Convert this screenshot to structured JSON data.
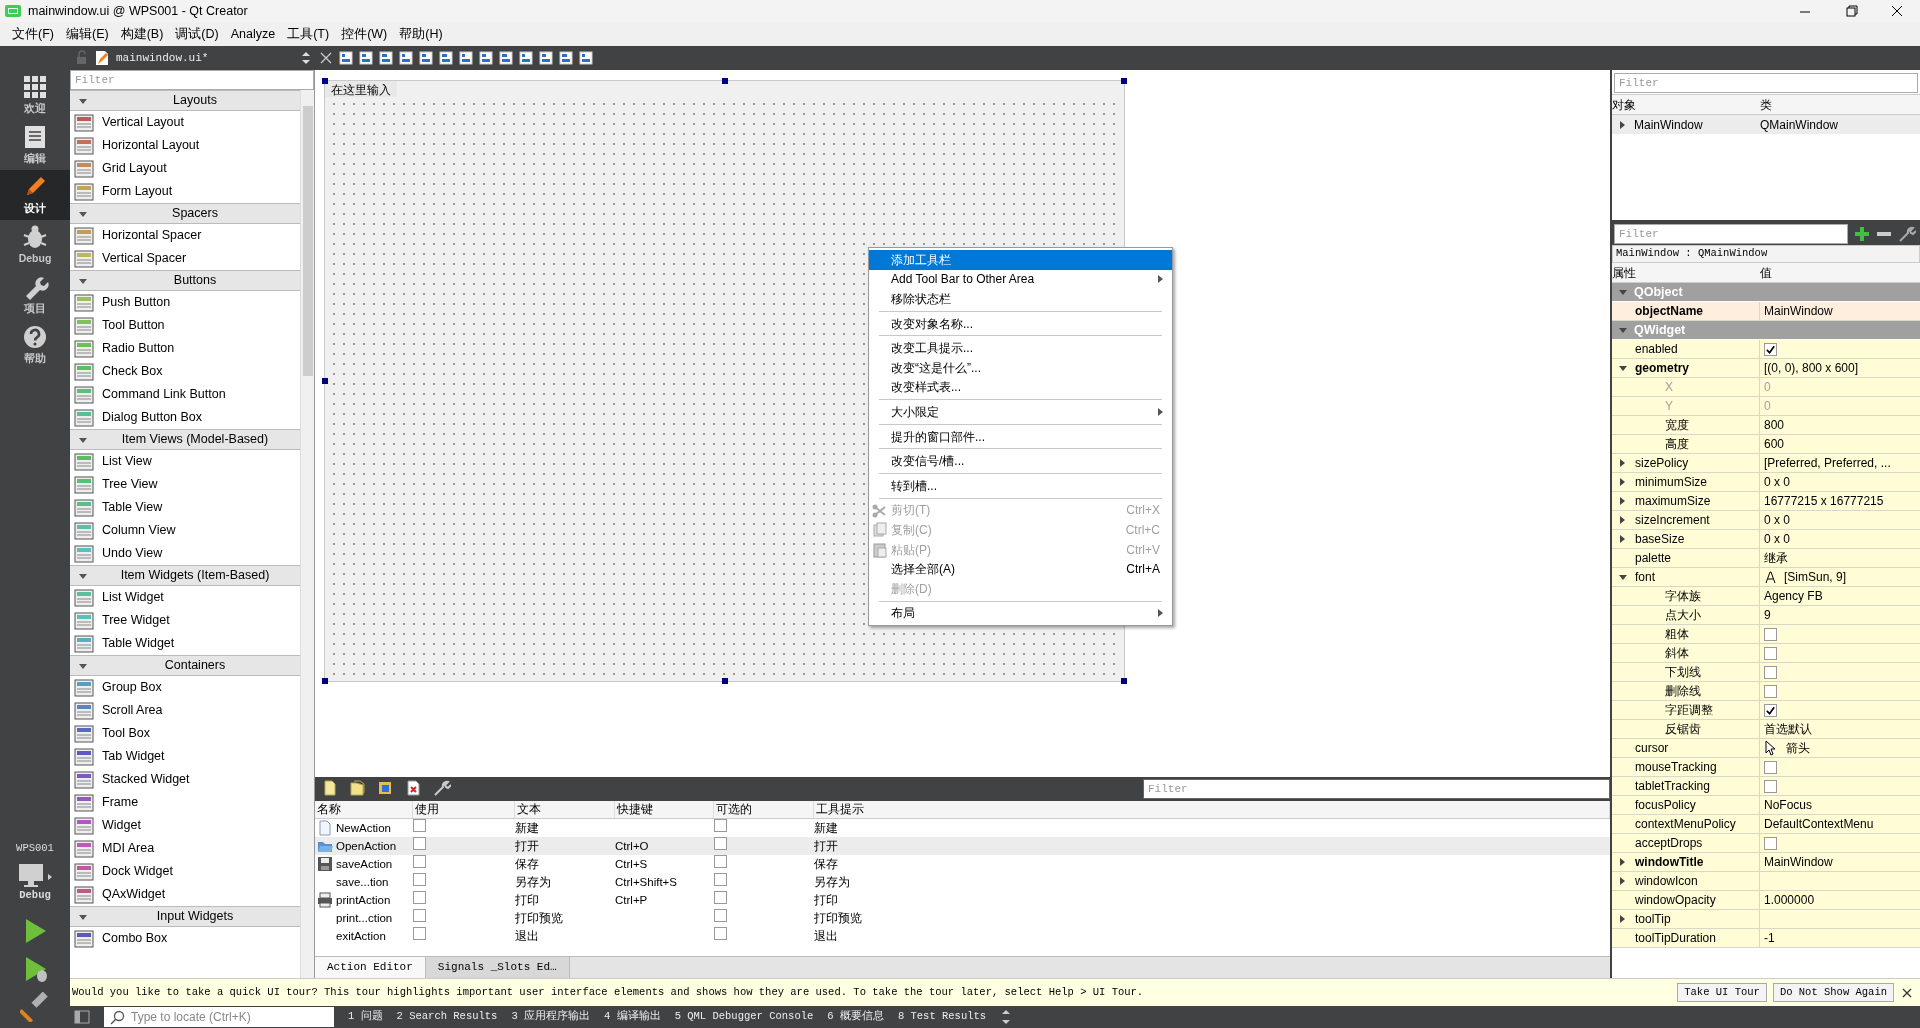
{
  "window": {
    "title": "mainwindow.ui @ WPS001 - Qt Creator"
  },
  "menu": [
    "文件(F)",
    "编辑(E)",
    "构建(B)",
    "调试(D)",
    "Analyze",
    "工具(T)",
    "控件(W)",
    "帮助(H)"
  ],
  "modes": [
    {
      "label": "欢迎",
      "selected": false
    },
    {
      "label": "编辑",
      "selected": false
    },
    {
      "label": "设计",
      "selected": true
    },
    {
      "label": "Debug",
      "selected": false
    },
    {
      "label": "项目",
      "selected": false
    },
    {
      "label": "帮助",
      "selected": false
    }
  ],
  "kit": {
    "project": "WPS001",
    "build": "Debug"
  },
  "editor_toolbar": {
    "file": "mainwindow.ui*"
  },
  "widget_box": {
    "placeholder": "Filter",
    "categories": [
      {
        "title": "Layouts",
        "expanded": true,
        "items": [
          "Vertical Layout",
          "Horizontal Layout",
          "Grid Layout",
          "Form Layout"
        ]
      },
      {
        "title": "Spacers",
        "expanded": true,
        "items": [
          "Horizontal Spacer",
          "Vertical Spacer"
        ]
      },
      {
        "title": "Buttons",
        "expanded": true,
        "items": [
          "Push Button",
          "Tool Button",
          "Radio Button",
          "Check Box",
          "Command Link Button",
          "Dialog Button Box"
        ]
      },
      {
        "title": "Item Views (Model-Based)",
        "expanded": true,
        "items": [
          "List View",
          "Tree View",
          "Table View",
          "Column View",
          "Undo View"
        ]
      },
      {
        "title": "Item Widgets (Item-Based)",
        "expanded": true,
        "items": [
          "List Widget",
          "Tree Widget",
          "Table Widget"
        ]
      },
      {
        "title": "Containers",
        "expanded": true,
        "items": [
          "Group Box",
          "Scroll Area",
          "Tool Box",
          "Tab Widget",
          "Stacked Widget",
          "Frame",
          "Widget",
          "MDI Area",
          "Dock Widget",
          "QAxWidget"
        ]
      },
      {
        "title": "Input Widgets",
        "expanded": true,
        "items": [
          "Combo Box"
        ]
      }
    ]
  },
  "form": {
    "menu_placeholder": "在这里输入"
  },
  "context_menu": [
    {
      "kind": "item",
      "label": "添加工具栏",
      "selected": true
    },
    {
      "kind": "item",
      "label": "Add Tool Bar to Other Area",
      "submenu": true,
      "selected": false
    },
    {
      "kind": "item",
      "label": "移除状态栏",
      "selected": false
    },
    {
      "kind": "separator"
    },
    {
      "kind": "item",
      "label": "改变对象名称...",
      "selected": false
    },
    {
      "kind": "separator"
    },
    {
      "kind": "item",
      "label": "改变工具提示...",
      "selected": false
    },
    {
      "kind": "item",
      "label": "改变“这是什么”...",
      "selected": false
    },
    {
      "kind": "item",
      "label": "改变样式表...",
      "selected": false
    },
    {
      "kind": "separator"
    },
    {
      "kind": "item",
      "label": "大小限定",
      "submenu": true,
      "selected": false
    },
    {
      "kind": "separator"
    },
    {
      "kind": "item",
      "label": "提升的窗口部件...",
      "selected": false
    },
    {
      "kind": "separator"
    },
    {
      "kind": "item",
      "label": "改变信号/槽...",
      "selected": false
    },
    {
      "kind": "separator"
    },
    {
      "kind": "item",
      "label": "转到槽...",
      "selected": false
    },
    {
      "kind": "separator"
    },
    {
      "kind": "item",
      "label": "剪切(T)",
      "shortcut": "Ctrl+X",
      "disabled": true,
      "selected": false
    },
    {
      "kind": "item",
      "label": "复制(C)",
      "shortcut": "Ctrl+C",
      "disabled": true,
      "selected": false
    },
    {
      "kind": "item",
      "label": "粘贴(P)",
      "shortcut": "Ctrl+V",
      "disabled": true,
      "selected": false
    },
    {
      "kind": "item",
      "label": "选择全部(A)",
      "shortcut": "Ctrl+A",
      "disabled": false,
      "selected": false
    },
    {
      "kind": "item",
      "label": "删除(D)",
      "disabled": true,
      "selected": false
    },
    {
      "kind": "separator"
    },
    {
      "kind": "item",
      "label": "布局",
      "submenu": true,
      "selected": false
    }
  ],
  "action_editor": {
    "filter_placeholder": "Filter",
    "columns": [
      "名称",
      "使用",
      "文本",
      "快捷键",
      "可选的",
      "工具提示"
    ],
    "rows": [
      {
        "name": "NewAction",
        "used": false,
        "text": "新建",
        "checkable": false,
        "tooltip": "新建",
        "selected": false
      },
      {
        "name": "OpenAction",
        "used": false,
        "text": "打开",
        "shortcut": "Ctrl+O",
        "checkable": false,
        "tooltip": "打开",
        "selected": true
      },
      {
        "name": "saveAction",
        "used": false,
        "text": "保存",
        "shortcut": "Ctrl+S",
        "checkable": false,
        "tooltip": "保存",
        "selected": false
      },
      {
        "name": "save...tion",
        "used": false,
        "text": "另存为",
        "shortcut": "Ctrl+Shift+S",
        "checkable": false,
        "tooltip": "另存为",
        "selected": false
      },
      {
        "name": "printAction",
        "used": false,
        "text": "打印",
        "shortcut": "Ctrl+P",
        "checkable": false,
        "tooltip": "打印",
        "selected": false
      },
      {
        "name": "print...ction",
        "used": false,
        "text": "打印预览",
        "checkable": false,
        "tooltip": "打印预览",
        "selected": false
      },
      {
        "name": "exitAction",
        "used": false,
        "text": "退出",
        "checkable": false,
        "tooltip": "退出",
        "selected": false
      }
    ],
    "tabs": [
      {
        "label": "Action Editor",
        "selected": true
      },
      {
        "label": "Signals _Slots Ed…",
        "selected": false
      }
    ]
  },
  "object_inspector": {
    "placeholder": "Filter",
    "columns": [
      "对象",
      "类"
    ],
    "rows": [
      {
        "object": "MainWindow",
        "class": "QMainWindow",
        "expanded": false
      }
    ]
  },
  "property_editor": {
    "placeholder": "Filter",
    "class_label": "MainWindow : QMainWindow",
    "columns": [
      "属性",
      "值"
    ],
    "groups": [
      {
        "title": "QObject",
        "expanded": true,
        "properties": [
          {
            "name": "objectName",
            "bold": true,
            "kind": "text",
            "value": "MainWindow"
          }
        ]
      },
      {
        "title": "QWidget",
        "expanded": true,
        "properties": [
          {
            "name": "enabled",
            "kind": "check",
            "checked": true
          },
          {
            "name": "geometry",
            "bold": true,
            "kind": "text",
            "value": "[(0, 0), 800 x 600]",
            "expanded": true,
            "children": [
              {
                "name": "X",
                "kind": "text",
                "value": "0",
                "disabled": true
              },
              {
                "name": "Y",
                "kind": "text",
                "value": "0",
                "disabled": true
              },
              {
                "name": "宽度",
                "kind": "text",
                "value": "800"
              },
              {
                "name": "高度",
                "kind": "text",
                "value": "600"
              }
            ]
          },
          {
            "name": "sizePolicy",
            "kind": "text",
            "value": "[Preferred, Preferred, ...",
            "expanded": false
          },
          {
            "name": "minimumSize",
            "kind": "text",
            "value": "0 x 0",
            "expanded": false
          },
          {
            "name": "maximumSize",
            "kind": "text",
            "value": "16777215 x 16777215",
            "expanded": false
          },
          {
            "name": "sizeIncrement",
            "kind": "text",
            "value": "0 x 0",
            "expanded": false
          },
          {
            "name": "baseSize",
            "kind": "text",
            "value": "0 x 0",
            "expanded": false
          },
          {
            "name": "palette",
            "kind": "text",
            "value": "继承"
          },
          {
            "name": "font",
            "kind": "font",
            "value": "[SimSun, 9]",
            "expanded": true,
            "children": [
              {
                "name": "字体族",
                "kind": "text",
                "value": "Agency FB"
              },
              {
                "name": "点大小",
                "kind": "text",
                "value": "9"
              },
              {
                "name": "粗体",
                "kind": "check",
                "checked": false
              },
              {
                "name": "斜体",
                "kind": "check",
                "checked": false
              },
              {
                "name": "下划线",
                "kind": "check",
                "checked": false
              },
              {
                "name": "删除线",
                "kind": "check",
                "checked": false
              },
              {
                "name": "字距调整",
                "kind": "check",
                "checked": true
              },
              {
                "name": "反锯齿",
                "kind": "text",
                "value": "首选默认"
              }
            ]
          },
          {
            "name": "cursor",
            "kind": "cursor",
            "value": "箭头"
          },
          {
            "name": "mouseTracking",
            "kind": "check",
            "checked": false
          },
          {
            "name": "tabletTracking",
            "kind": "check",
            "checked": false
          },
          {
            "name": "focusPolicy",
            "kind": "text",
            "value": "NoFocus"
          },
          {
            "name": "contextMenuPolicy",
            "kind": "text",
            "value": "DefaultContextMenu"
          },
          {
            "name": "acceptDrops",
            "kind": "check",
            "checked": false
          },
          {
            "name": "windowTitle",
            "bold": true,
            "kind": "text",
            "value": "MainWindow",
            "expanded": false
          },
          {
            "name": "windowIcon",
            "kind": "text",
            "expanded": false
          },
          {
            "name": "windowOpacity",
            "kind": "text",
            "value": "1.000000"
          },
          {
            "name": "toolTip",
            "kind": "text",
            "expanded": false
          },
          {
            "name": "toolTipDuration",
            "kind": "text",
            "value": "-1"
          }
        ]
      }
    ]
  },
  "tour": {
    "text": "Would you like to take a quick UI tour? This tour highlights important user interface elements and shows how they are used. To take the tour later, select Help > UI Tour.",
    "buttons": [
      "Take UI Tour",
      "Do Not Show Again"
    ]
  },
  "status_bar": {
    "placeholder": "Type to locate (Ctrl+K)",
    "panes": [
      "1 问题",
      "2 Search Results",
      "3 应用程序输出",
      "4 编译输出",
      "5 QML Debugger Console",
      "6 概要信息",
      "8 Test Results"
    ]
  }
}
